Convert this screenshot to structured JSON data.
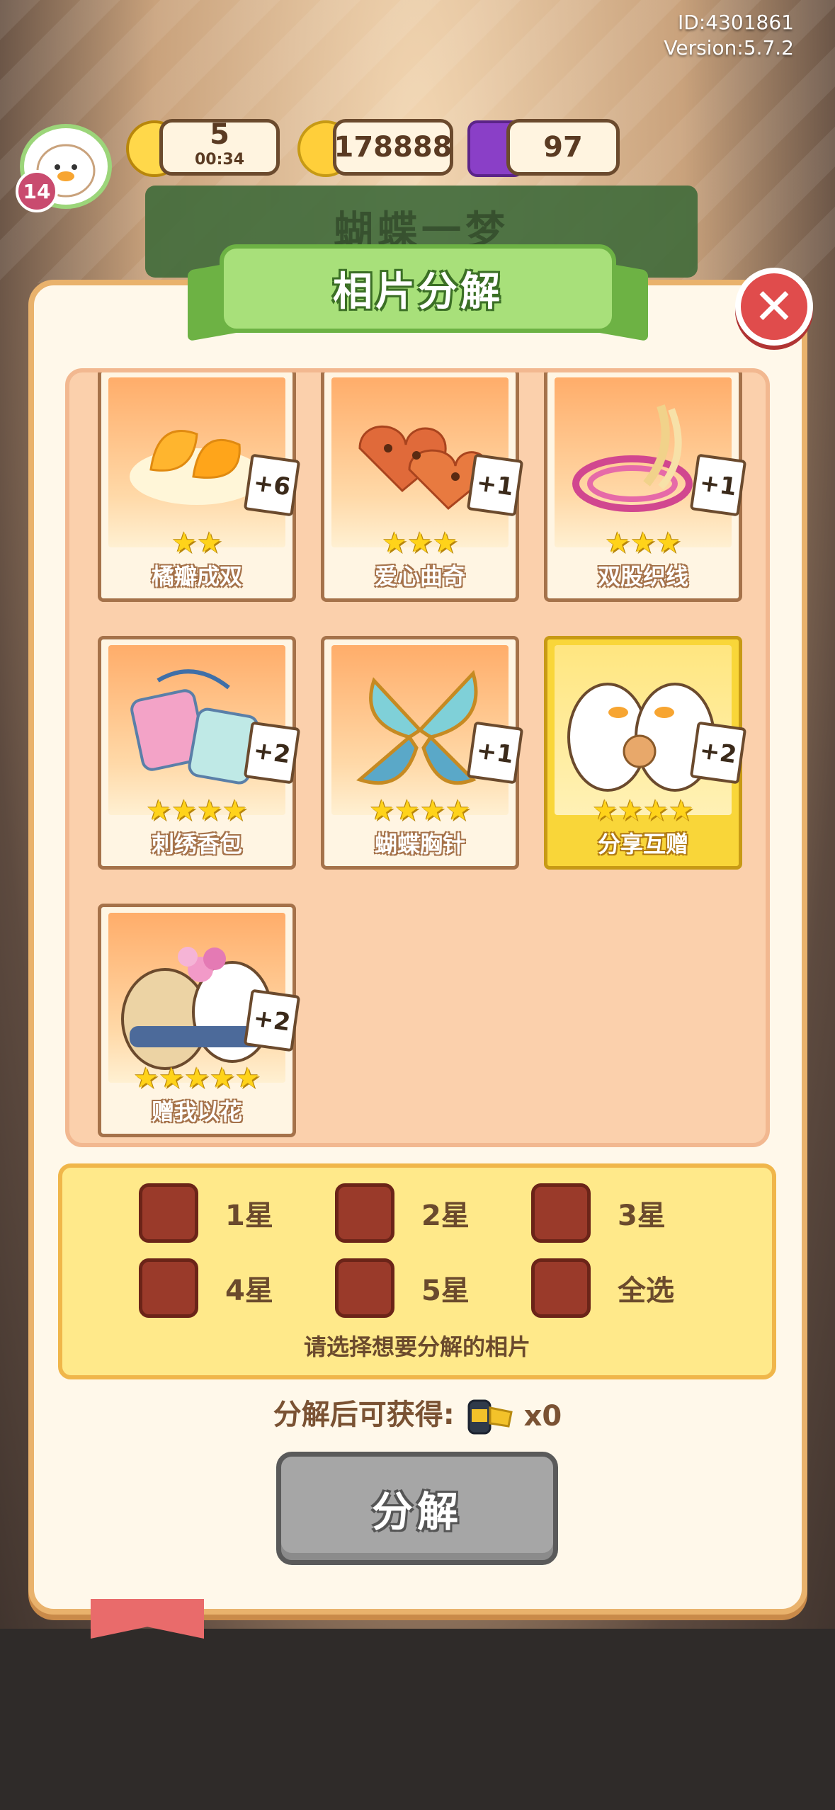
{
  "header": {
    "id_text": "ID:4301861",
    "version_text": "Version:5.7.2"
  },
  "hud": {
    "level": "14",
    "energy": "5",
    "energy_timer": "00:34",
    "coins": "178888",
    "gems": "97"
  },
  "background_banner": "蝴蝶一梦",
  "dialog": {
    "title": "相片分解",
    "cards": [
      {
        "name": "橘瓣成双",
        "stars": "★★",
        "count": "+6",
        "highlight": false
      },
      {
        "name": "爱心曲奇",
        "stars": "★★★",
        "count": "+1",
        "highlight": false
      },
      {
        "name": "双股织线",
        "stars": "★★★",
        "count": "+1",
        "highlight": false
      },
      {
        "name": "刺绣香包",
        "stars": "★★★★",
        "count": "+2",
        "highlight": false
      },
      {
        "name": "蝴蝶胸针",
        "stars": "★★★★",
        "count": "+1",
        "highlight": false
      },
      {
        "name": "分享互赠",
        "stars": "★★★★",
        "count": "+2",
        "highlight": true
      },
      {
        "name": "赠我以花",
        "stars": "★★★★★",
        "count": "+2",
        "highlight": false
      }
    ],
    "options": [
      "1星",
      "2星",
      "3星",
      "4星",
      "5星",
      "全选"
    ],
    "select_hint": "请选择想要分解的相片",
    "reward_label": "分解后可获得:",
    "reward_count": "x0",
    "decompose_button": "分解"
  },
  "colors": {
    "panel_border": "#e9b26c",
    "accent_green": "#a8e07a",
    "close_red": "#e04c4c",
    "checkbox": "#9a3a2a"
  }
}
